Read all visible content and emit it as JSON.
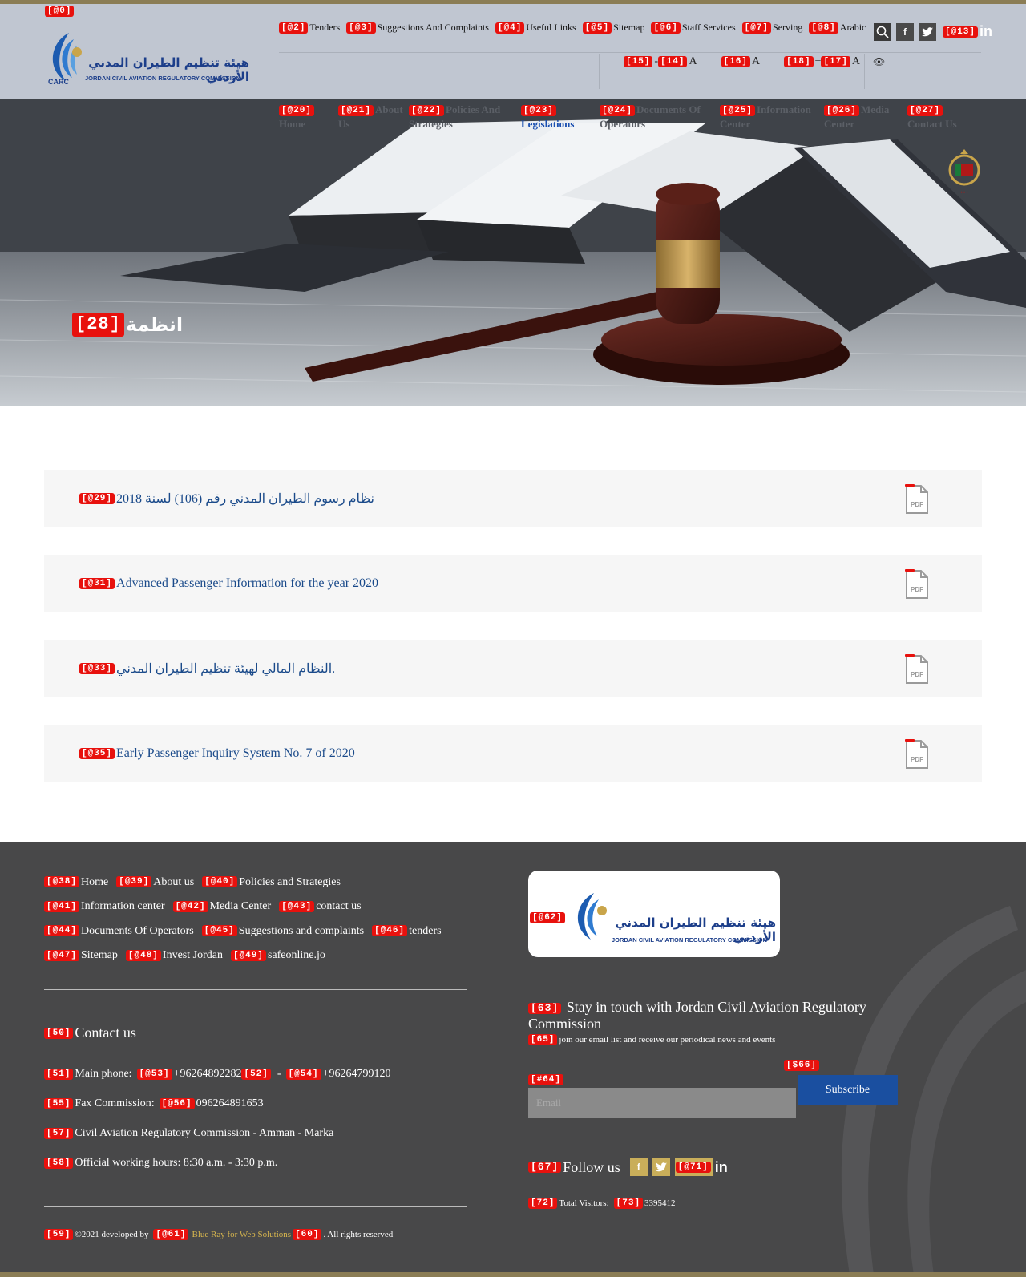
{
  "header": {
    "top_links": [
      {
        "tag": "[@2]",
        "label": "Tenders"
      },
      {
        "tag": "[@3]",
        "label": "Suggestions And Complaints"
      },
      {
        "tag": "[@4]",
        "label": "Useful Links"
      },
      {
        "tag": "[@5]",
        "label": "Sitemap"
      },
      {
        "tag": "[@6]",
        "label": "Staff Services"
      },
      {
        "tag": "[@7]",
        "label": "Serving"
      },
      {
        "tag": "[@8]",
        "label": "Arabic"
      }
    ],
    "logo_tag": "[@0]",
    "logo_ar": "هيئة تنظيم الطيران المدني الأردني",
    "logo_en": "JORDAN CIVIL AVIATION REGULATORY COMMISSION",
    "logo_abbr": "CARC",
    "font_controls": {
      "decrease_tag": "[15]",
      "decrease_sym": "-",
      "a1_tag": "[14]",
      "a1": "A",
      "a2_tag": "[16]",
      "a2": "A",
      "increase_tag": "[18]",
      "increase_sym": "+",
      "a3_tag": "[17]",
      "a3": "A"
    },
    "social_tag": "[@13]",
    "linkedin_label": "in"
  },
  "main_nav": [
    {
      "tag": "[@20]",
      "label": "Home"
    },
    {
      "tag": "[@21]",
      "label": "About Us"
    },
    {
      "tag": "[@22]",
      "label": "Policies And Strategies"
    },
    {
      "tag": "[@23]",
      "label": "Legislations"
    },
    {
      "tag": "[@24]",
      "label": "Documents Of Operators"
    },
    {
      "tag": "[@25]",
      "label": "Information Center"
    },
    {
      "tag": "[@26]",
      "label": "Media Center"
    },
    {
      "tag": "[@27]",
      "label": "Contact Us"
    }
  ],
  "hero": {
    "tag": "[28]",
    "title": "انظمة"
  },
  "documents": [
    {
      "tag": "[@29]",
      "title": "نظام رسوم الطيران المدني رقم (106) لسنة 2018"
    },
    {
      "tag": "[@31]",
      "title": "Advanced Passenger Information for the year 2020"
    },
    {
      "tag": "[@33]",
      "title": "النظام المالي لهيئة تنظيم الطيران المدني."
    },
    {
      "tag": "[@35]",
      "title": "Early Passenger Inquiry System No. 7 of 2020"
    }
  ],
  "pdf_label": "PDF",
  "footer": {
    "links": [
      {
        "tag": "[@38]",
        "label": "Home"
      },
      {
        "tag": "[@39]",
        "label": "About us"
      },
      {
        "tag": "[@40]",
        "label": "Policies and Strategies"
      },
      {
        "tag": "[@41]",
        "label": "Information center"
      },
      {
        "tag": "[@42]",
        "label": "Media Center"
      },
      {
        "tag": "[@43]",
        "label": "contact us"
      },
      {
        "tag": "[@44]",
        "label": "Documents Of Operators"
      },
      {
        "tag": "[@45]",
        "label": "Suggestions and complaints"
      },
      {
        "tag": "[@46]",
        "label": "tenders"
      },
      {
        "tag": "[@47]",
        "label": "Sitemap"
      },
      {
        "tag": "[@48]",
        "label": "Invest Jordan"
      },
      {
        "tag": "[@49]",
        "label": "safeonline.jo"
      }
    ],
    "contact_tag": "[50]",
    "contact_title": "Contact us",
    "main_phone": {
      "tag": "[51]",
      "label": "Main phone:",
      "p1_tag": "[@53]",
      "p1": "+96264892282",
      "sep_tag": "[52]",
      "sep": "-",
      "p2_tag": "[@54]",
      "p2": "+96264799120"
    },
    "fax": {
      "tag": "[55]",
      "label": "Fax Commission:",
      "num_tag": "[@56]",
      "num": "096264891653"
    },
    "address": {
      "tag": "[57]",
      "text": "Civil Aviation Regulatory Commission - Amman - Marka"
    },
    "hours": {
      "tag": "[58]",
      "text": "Official working hours:  8:30 a.m. - 3:30 p.m."
    },
    "copyright": {
      "tag": "[59]",
      "text": "©2021 developed by",
      "dev_tag": "[@61]",
      "dev": "Blue Ray for Web Solutions",
      "end_tag": "[60]",
      "end": ". All rights reserved"
    },
    "logo_tag": "[@62]",
    "stay_tag": "[63]",
    "stay_title": "Stay in touch with Jordan Civil Aviation Regulatory Commission",
    "stay_sub_tag": "[65]",
    "stay_sub": "join our email list and receive our periodical news and events",
    "email_tag": "[#64]",
    "email_placeholder": "Email",
    "subscribe_tag": "[$66]",
    "subscribe_label": "Subscribe",
    "follow_tag": "[67]",
    "follow_label": "Follow us",
    "follow_social_tag": "[@71]",
    "visitors_tag": "[72]",
    "visitors_label": "Total Visitors:",
    "visitors_count_tag": "[73]",
    "visitors_count": "3395412"
  },
  "colors": {
    "gold": "#8b7d55",
    "header_bg": "#c0c6d1",
    "footer_bg": "#484849",
    "link_blue": "#1a4a8a",
    "subscribe_blue": "#1a4fa0",
    "tag_red": "#e8110d"
  }
}
